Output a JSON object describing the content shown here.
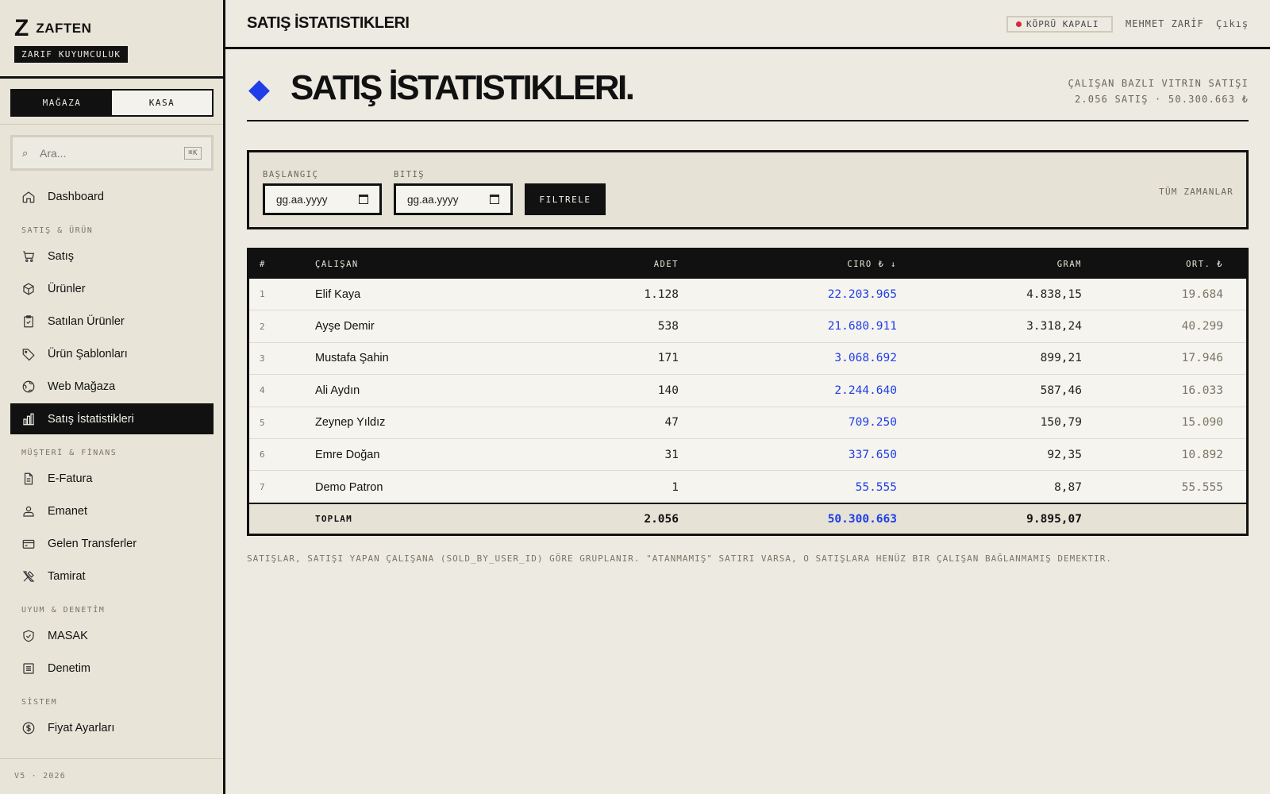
{
  "brand": {
    "logo": "Z",
    "name": "ZAFTEN",
    "subtitle": "ZARIF KUYUMCULUK"
  },
  "mode_toggle": {
    "store": "MAĞAZA",
    "cashier": "KASA"
  },
  "search": {
    "placeholder": "Ara...",
    "shortcut": "⌘K",
    "icon": "search-icon"
  },
  "nav": {
    "dashboard": "Dashboard",
    "section_sales": "SATIŞ & ÜRÜN",
    "sales": "Satış",
    "products": "Ürünler",
    "sold_products": "Satılan Ürünler",
    "templates": "Ürün Şablonları",
    "web_store": "Web Mağaza",
    "sales_stats": "Satış İstatistikleri",
    "section_customer": "MÜŞTERİ & FİNANS",
    "einvoice": "E-Fatura",
    "escrow": "Emanet",
    "transfers": "Gelen Transferler",
    "repair": "Tamirat",
    "section_compliance": "UYUM & DENETİM",
    "masak": "MASAK",
    "audit": "Denetim",
    "section_system": "SİSTEM",
    "price_settings": "Fiyat Ayarları"
  },
  "version": "V5 · 2026",
  "topbar": {
    "title": "SATIŞ İSTATISTIKLERI",
    "bridge_status": "KÖPRÜ KAPALI",
    "user": "MEHMET ZARİF",
    "logout": "Çıkış",
    "status_color": "#d7263d"
  },
  "header": {
    "title": "SATIŞ İSTATISTIKLERI.",
    "meta_line1": "ÇALIŞAN BAZLI VITRIN SATIŞI",
    "meta_line2": "2.056 SATIŞ · 50.300.663 ₺",
    "accent": "#1f3ee8"
  },
  "filter": {
    "start_label": "BAŞLANGIÇ",
    "end_label": "BITIŞ",
    "start_value": "gg.aa.yyyy",
    "end_value": "gg.aa.yyyy",
    "button": "FILTRELE",
    "range": "TÜM ZAMANLAR"
  },
  "table": {
    "headers": {
      "num": "#",
      "name": "ÇALIŞAN",
      "count": "ADET",
      "revenue": "CIRO ₺ ↓",
      "gram": "GRAM",
      "avg": "ORT. ₺"
    },
    "rows": [
      {
        "num": "1",
        "name": "Elif Kaya",
        "count": "1.128",
        "revenue": "22.203.965",
        "gram": "4.838,15",
        "avg": "19.684"
      },
      {
        "num": "2",
        "name": "Ayşe Demir",
        "count": "538",
        "revenue": "21.680.911",
        "gram": "3.318,24",
        "avg": "40.299"
      },
      {
        "num": "3",
        "name": "Mustafa Şahin",
        "count": "171",
        "revenue": "3.068.692",
        "gram": "899,21",
        "avg": "17.946"
      },
      {
        "num": "4",
        "name": "Ali Aydın",
        "count": "140",
        "revenue": "2.244.640",
        "gram": "587,46",
        "avg": "16.033"
      },
      {
        "num": "5",
        "name": "Zeynep Yıldız",
        "count": "47",
        "revenue": "709.250",
        "gram": "150,79",
        "avg": "15.090"
      },
      {
        "num": "6",
        "name": "Emre Doğan",
        "count": "31",
        "revenue": "337.650",
        "gram": "92,35",
        "avg": "10.892"
      },
      {
        "num": "7",
        "name": "Demo Patron",
        "count": "1",
        "revenue": "55.555",
        "gram": "8,87",
        "avg": "55.555"
      }
    ],
    "total": {
      "label": "TOPLAM",
      "count": "2.056",
      "revenue": "50.300.663",
      "gram": "9.895,07"
    }
  },
  "footnote": "SATIŞLAR, SATIŞI YAPAN ÇALIŞANA (SOLD_BY_USER_ID) GÖRE GRUPLANIR. \"ATANMAMIŞ\" SATIRI VARSA, O SATIŞLARA HENÜZ BIR ÇALIŞAN BAĞLANMAMIŞ DEMEKTIR."
}
